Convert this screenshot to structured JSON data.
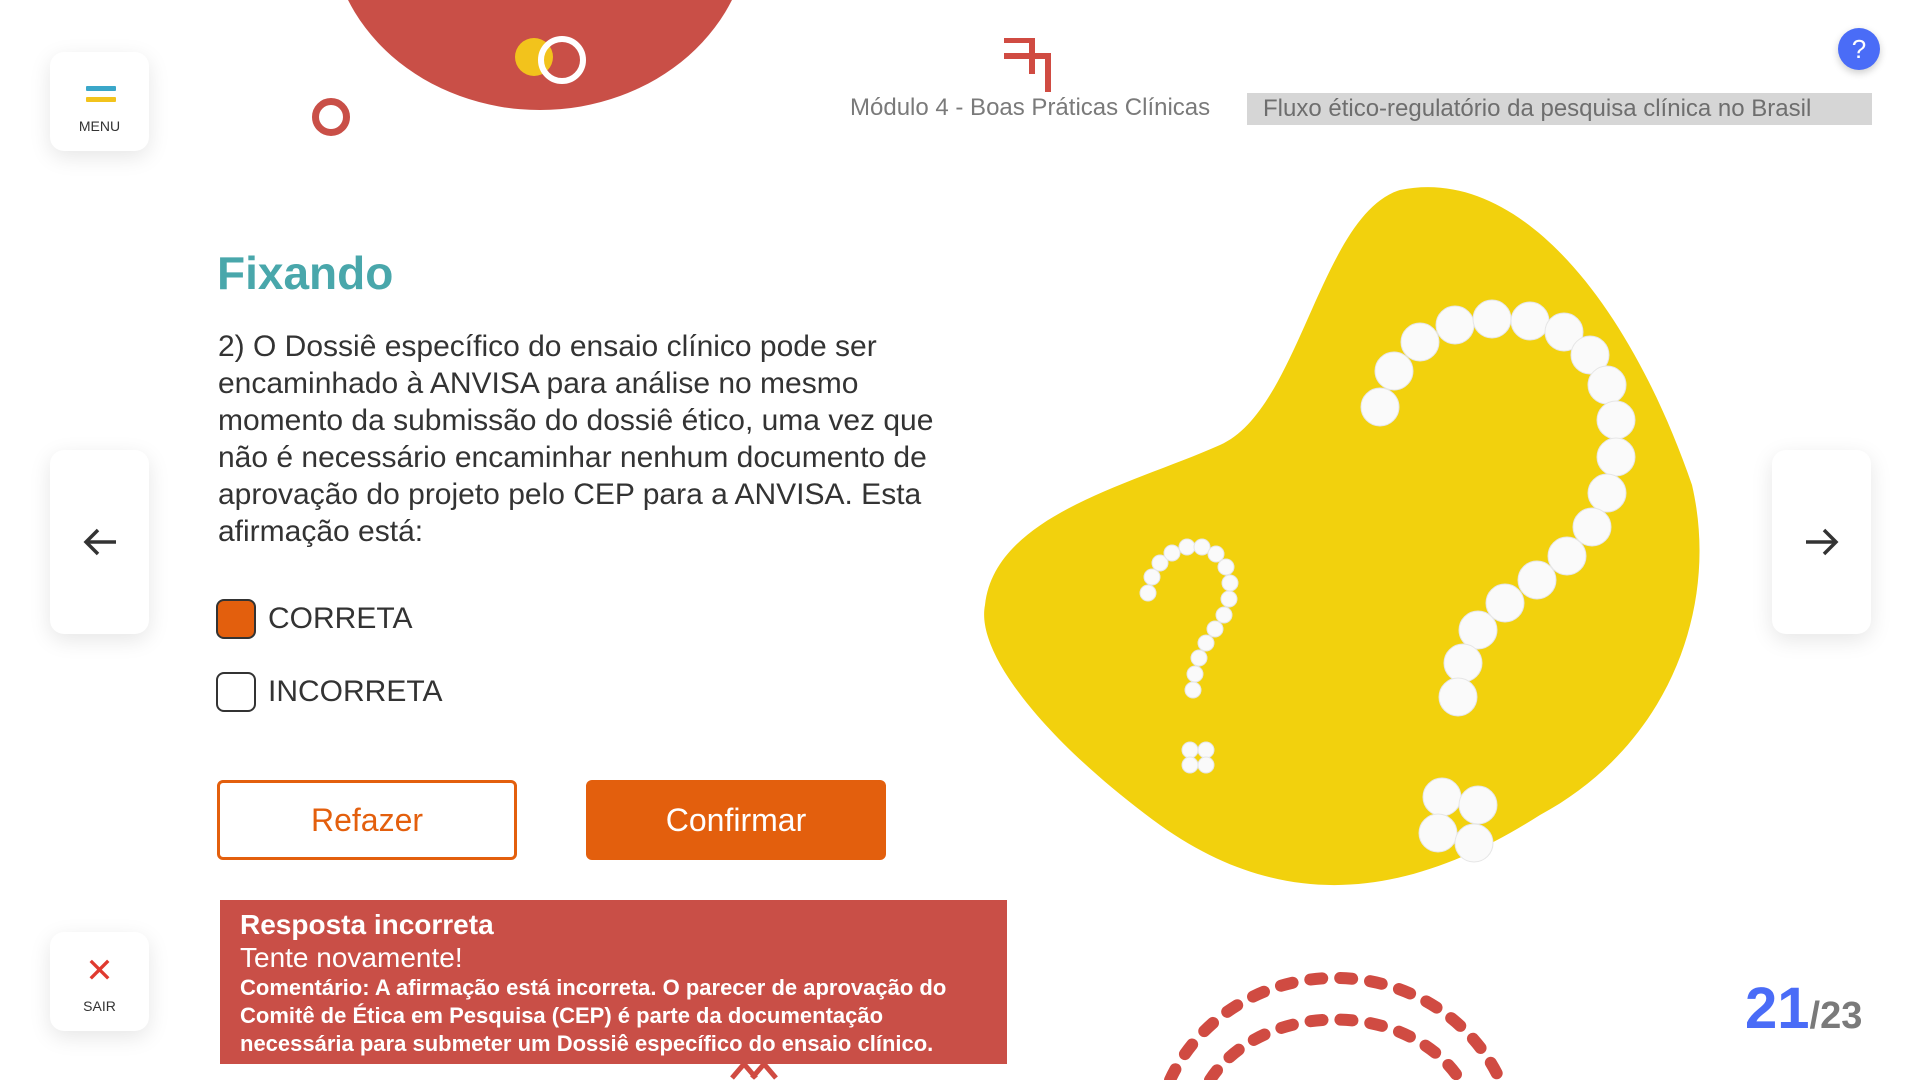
{
  "menu": {
    "label": "MENU",
    "colors": [
      "#3aa7c9",
      "#f2c31c"
    ]
  },
  "exit": {
    "label": "SAIR",
    "icon": "close-icon"
  },
  "nav": {
    "prev_icon": "arrow-left-icon",
    "next_icon": "arrow-right-icon"
  },
  "help": {
    "label": "?"
  },
  "header": {
    "module": "Módulo 4 - Boas Práticas Clínicas",
    "topic": "Fluxo ético-regulatório da pesquisa clínica no Brasil"
  },
  "quiz": {
    "title": "Fixando",
    "question": "2) O Dossiê específico do ensaio clínico pode ser encaminhado à ANVISA para análise no mesmo momento da submissão do dossiê ético, uma vez que não é necessário encaminhar nenhum documento de aprovação do projeto pelo CEP para a ANVISA. Esta afirmação está:",
    "options": [
      {
        "label": "CORRETA",
        "checked": true
      },
      {
        "label": "INCORRETA",
        "checked": false
      }
    ],
    "redo_label": "Refazer",
    "confirm_label": "Confirmar"
  },
  "feedback": {
    "title": "Resposta incorreta",
    "subtitle": "Tente novamente!",
    "comment": "Comentário: A afirmação está incorreta. O parecer de aprovação do Comitê de Ética em Pesquisa (CEP) é parte da documentação necessária para submeter um Dossiê específico do ensaio clínico."
  },
  "pager": {
    "current": "21",
    "total": "/23"
  },
  "colors": {
    "accent": "#e35f0d",
    "title": "#49a7ab",
    "feedback_bg": "#c94f47",
    "pager": "#4a6cf7",
    "blob": "#f2d10d"
  }
}
